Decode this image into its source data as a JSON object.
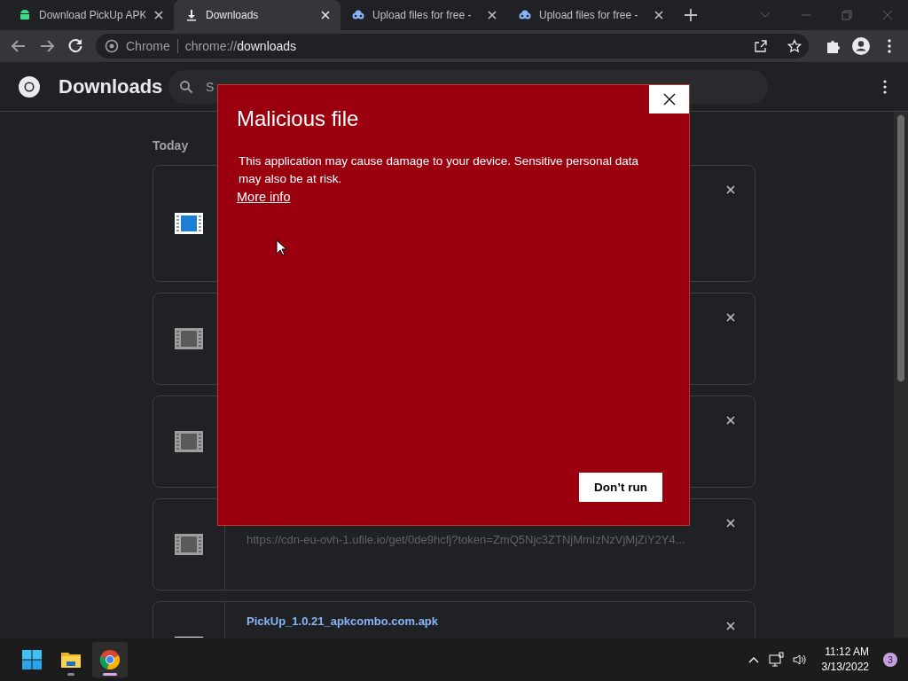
{
  "tabs": [
    {
      "title": "Download PickUp APK",
      "kind": "android",
      "selected": false
    },
    {
      "title": "Downloads",
      "kind": "download",
      "selected": true
    },
    {
      "title": "Upload files for free - ",
      "kind": "cloud",
      "selected": false
    },
    {
      "title": "Upload files for free - ",
      "kind": "cloud",
      "selected": false
    }
  ],
  "address": {
    "site_label": "Chrome",
    "url_scheme": "chrome://",
    "url_host": "downloads"
  },
  "header": {
    "title": "Downloads",
    "search": {
      "placeholder": "S"
    }
  },
  "section": "Today",
  "downloads": [
    {
      "failed": false
    },
    {
      "failed": true
    },
    {
      "failed": true
    },
    {
      "failed": true,
      "url": "https://cdn-eu-ovh-1.ufile.io/get/0de9hcfj?token=ZmQ5Njc3ZTNjMmIzNzVjMjZiY2Y4..."
    },
    {
      "failed": false,
      "filename": "PickUp_1.0.21_apkcombo.com.apk"
    }
  ],
  "dialog": {
    "title": "Malicious file",
    "message": "This application may cause damage to your device. Sensitive personal data may also be at risk.",
    "link": "More info",
    "button": "Don’t run"
  },
  "taskbar": {
    "apps": [
      {
        "kind": "start",
        "selected": false
      },
      {
        "kind": "folder",
        "selected": false
      },
      {
        "kind": "chrome",
        "selected": true
      }
    ],
    "time": "11:12 AM",
    "date": "3/13/2022",
    "notifications": "3"
  }
}
